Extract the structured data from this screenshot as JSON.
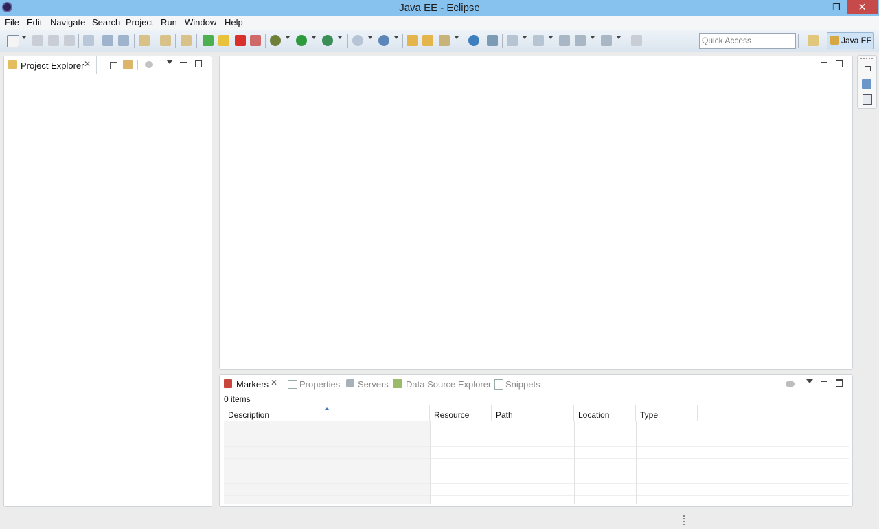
{
  "window": {
    "title": "Java EE - Eclipse"
  },
  "menu": [
    "File",
    "Edit",
    "Navigate",
    "Search",
    "Project",
    "Run",
    "Window",
    "Help"
  ],
  "toolbar": {
    "quick_access_placeholder": "Quick Access",
    "perspective": "Java EE"
  },
  "explorer": {
    "tab_label": "Project Explorer"
  },
  "bottom": {
    "tabs": {
      "markers": "Markers",
      "properties": "Properties",
      "servers": "Servers",
      "data_source": "Data Source Explorer",
      "snippets": "Snippets"
    },
    "items_count": "0 items",
    "columns": [
      "Description",
      "Resource",
      "Path",
      "Location",
      "Type"
    ]
  },
  "colors": {
    "title_bar": "#87c2ef",
    "close": "#c74a4a",
    "toolbar_accent": "#dbe5ef"
  }
}
